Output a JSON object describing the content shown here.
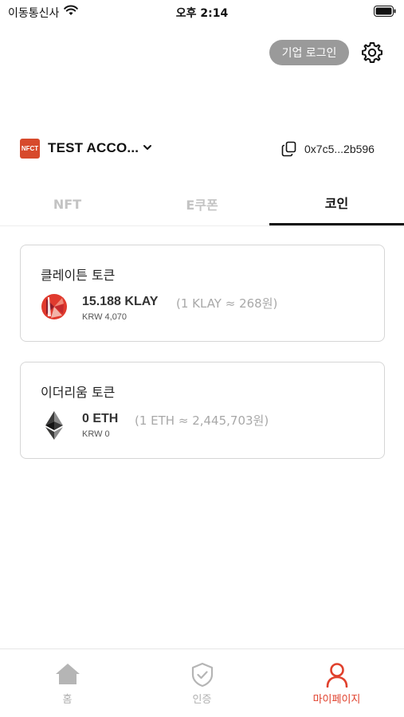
{
  "status_bar": {
    "carrier": "이동통신사",
    "time": "오후 2:14"
  },
  "header": {
    "business_login_label": "기업 로그인",
    "settings_icon": "gear-icon"
  },
  "account": {
    "logo_text": "NFCT",
    "name": "TEST ACCO...",
    "address": "0x7c5...2b596"
  },
  "tabs": [
    {
      "label": "NFT",
      "active": false
    },
    {
      "label": "E쿠폰",
      "active": false
    },
    {
      "label": "코인",
      "active": true
    }
  ],
  "coins": [
    {
      "title": "클레이튼 토큰",
      "amount": "15.188 KLAY",
      "rate": "(1 KLAY ≈ 268원)",
      "krw": "KRW 4,070",
      "icon": "klaytn-icon",
      "color": "#e03a2e"
    },
    {
      "title": "이더리움 토큰",
      "amount": "0 ETH",
      "rate": "(1 ETH ≈ 2,445,703원)",
      "krw": "KRW 0",
      "icon": "ethereum-icon",
      "color": "#3a3a3a"
    }
  ],
  "bottom_nav": [
    {
      "label": "홈",
      "icon": "home-icon",
      "active": false
    },
    {
      "label": "인증",
      "icon": "shield-check-icon",
      "active": false
    },
    {
      "label": "마이페이지",
      "icon": "user-icon",
      "active": true
    }
  ],
  "colors": {
    "accent": "#e0402c",
    "inactive": "#b0b0b0",
    "button_gray": "#9a9a9a"
  }
}
